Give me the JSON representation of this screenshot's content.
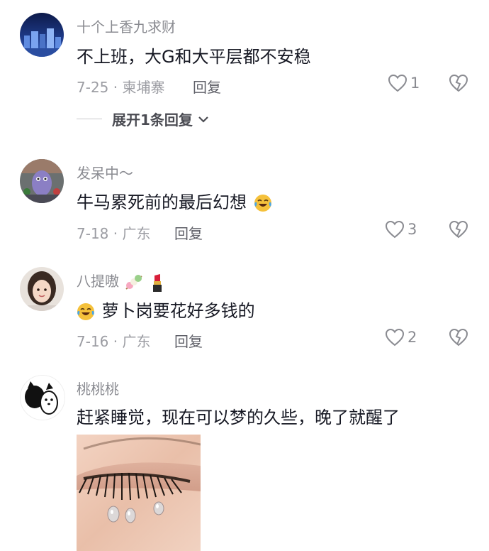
{
  "comments": [
    {
      "username": "十个上香九求财",
      "text": "不上班，大G和大平层都不安稳",
      "date": "7-25",
      "location": "柬埔寨",
      "reply_label": "回复",
      "likes": "1",
      "expand_label": "展开1条回复"
    },
    {
      "username": "发呆中～",
      "text": "牛马累死前的最后幻想",
      "emoji": "crying-laughing-emoji",
      "date": "7-18",
      "location": "广东",
      "reply_label": "回复",
      "likes": "3"
    },
    {
      "username": "八提嗷",
      "username_emojis": [
        "dango-emoji",
        "lipstick-emoji"
      ],
      "text": "萝卜岗要花好多钱的",
      "emoji": "crying-laughing-emoji",
      "date": "7-16",
      "location": "广东",
      "reply_label": "回复",
      "likes": "2"
    },
    {
      "username": "桃桃桃",
      "text": "赶紧睡觉，现在可以梦的久些，晚了就醒了",
      "image": "crying-eye-image"
    }
  ],
  "colors": {
    "text": "#161823",
    "meta": "#9c9da3",
    "username": "#8a8b91"
  }
}
